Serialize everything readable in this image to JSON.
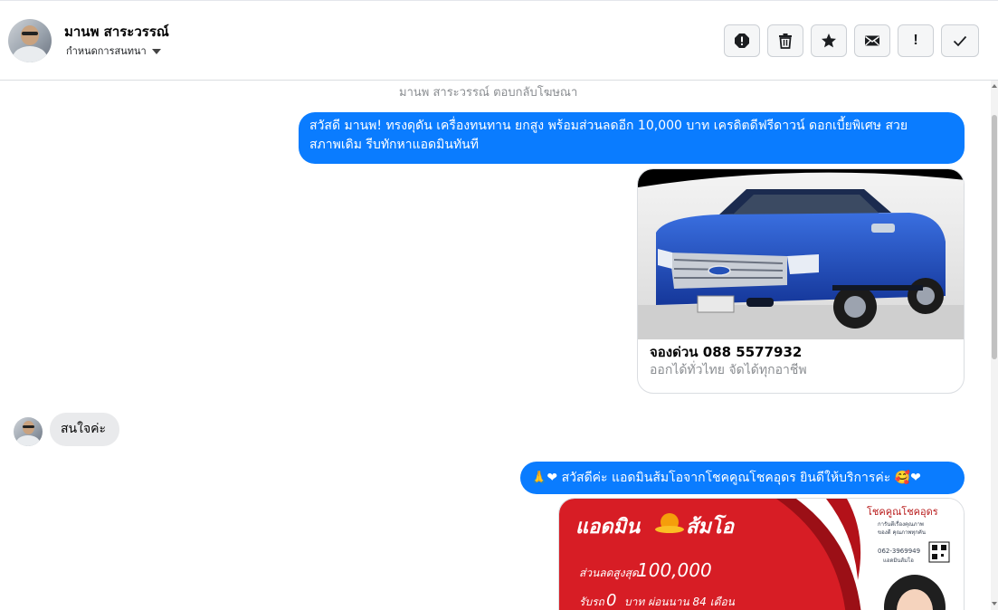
{
  "header": {
    "contact_name": "มานพ สาระวรรณ์",
    "assign_label": "กำหนดการสนทนา",
    "actions": [
      {
        "name": "report-icon",
        "label": ""
      },
      {
        "name": "trash-icon",
        "label": ""
      },
      {
        "name": "star-icon",
        "label": ""
      },
      {
        "name": "envelope-icon",
        "label": ""
      },
      {
        "name": "follow-up-icon",
        "label": "!"
      },
      {
        "name": "check-icon",
        "label": ""
      }
    ]
  },
  "conversation": {
    "meta_text": "มานพ สาระวรรณ์ ตอบกลับโฆษณา",
    "messages": [
      {
        "from": "page",
        "text_line1": "สวัสดี มานพ!  ทรงดุดัน เครื่องทนทาน ยกสูง พร้อมส่วนลดอีก 10,000 บาท เครดิตดีฟรีดาวน์ ดอกเบี้ยพิเศษ สวย",
        "text_line2": "สภาพเดิม รีบทักหาแอดมินทันที"
      },
      {
        "from": "page",
        "card_title": "จองด่วน 088 5577932",
        "card_subtitle": "ออกได้ทั่วไทย จัดได้ทุกอาชีพ"
      },
      {
        "from": "customer",
        "text": "สนใจค่ะ"
      },
      {
        "from": "page",
        "text": "สวัสดีค่ะ แอดมินส้มโอจากโชคคูณโชคอุดร ยินดีให้บริการค่ะ",
        "emoji_before": "🙏❤",
        "emoji_after": "🥰❤"
      }
    ],
    "promo": {
      "headline": "แอดมิน",
      "headline_2": "ส้มโอ",
      "discount_label": "ส่วนลดสูงสุด",
      "discount_value": "100,000",
      "down_label": "รับรถ",
      "down_value": "0",
      "down_suffix": "บาท ผ่อนนาน 84 เดือน",
      "brand": "โชคคูณโชคอุดร",
      "brand_sub1": "การันตีเรื่องคุณภาพ",
      "brand_sub2": "ของดี คุณภาพทุกคัน",
      "phone": "062-3969949",
      "phone_sub": "แอดมินส้มโอ"
    }
  },
  "colors": {
    "outgoing_bubble": "#0a7cff",
    "incoming_bubble": "#e9eaec",
    "promo_red": "#d71d25",
    "truck_blue": "#1f4fc4"
  }
}
